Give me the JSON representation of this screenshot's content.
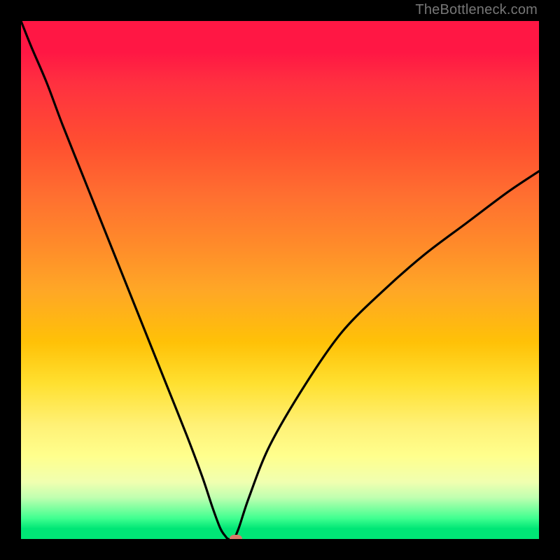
{
  "watermark": "TheBottleneck.com",
  "chart_data": {
    "type": "line",
    "title": "",
    "xlabel": "",
    "ylabel": "",
    "xlim": [
      0,
      100
    ],
    "ylim": [
      0,
      100
    ],
    "grid": false,
    "background_gradient": {
      "stops": [
        {
          "pos": 0,
          "color": "#ff1744"
        },
        {
          "pos": 24,
          "color": "#ff5030"
        },
        {
          "pos": 52,
          "color": "#ffa726"
        },
        {
          "pos": 70,
          "color": "#ffe030"
        },
        {
          "pos": 84,
          "color": "#ffff8d"
        },
        {
          "pos": 92,
          "color": "#c0ffb0"
        },
        {
          "pos": 100,
          "color": "#00e676"
        }
      ]
    },
    "series": [
      {
        "name": "bottleneck-curve",
        "color": "#000000",
        "x": [
          0,
          2,
          5,
          8,
          12,
          16,
          20,
          24,
          28,
          32,
          35,
          37,
          38.5,
          39.5,
          40,
          41,
          42,
          44,
          48,
          55,
          62,
          70,
          78,
          86,
          94,
          100
        ],
        "values": [
          100,
          95,
          88,
          80,
          70,
          60,
          50,
          40,
          30,
          20,
          12,
          6,
          2,
          0.5,
          0,
          0,
          2,
          8,
          18,
          30,
          40,
          48,
          55,
          61,
          67,
          71
        ]
      }
    ],
    "marker": {
      "name": "optimum-point",
      "x": 41.5,
      "y": 0,
      "color": "#d87a6a"
    }
  }
}
